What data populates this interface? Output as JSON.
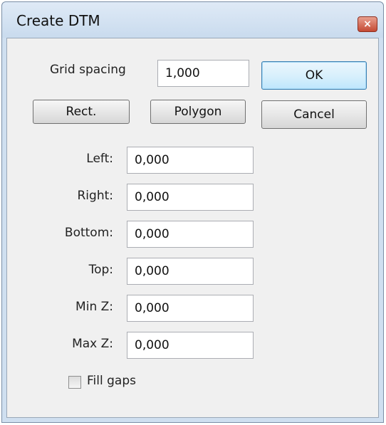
{
  "window": {
    "title": "Create DTM",
    "close_glyph": "×"
  },
  "grid_spacing": {
    "label": "Grid spacing",
    "value": "1,000"
  },
  "buttons": {
    "ok": "OK",
    "cancel": "Cancel",
    "rect": "Rect.",
    "polygon": "Polygon"
  },
  "fields": [
    {
      "label": "Left:",
      "value": "0,000"
    },
    {
      "label": "Right:",
      "value": "0,000"
    },
    {
      "label": "Bottom:",
      "value": "0,000"
    },
    {
      "label": "Top:",
      "value": "0,000"
    },
    {
      "label": "Min Z:",
      "value": "0,000"
    },
    {
      "label": "Max Z:",
      "value": "0,000"
    }
  ],
  "fill_gaps": {
    "label": "Fill gaps",
    "checked": false
  }
}
